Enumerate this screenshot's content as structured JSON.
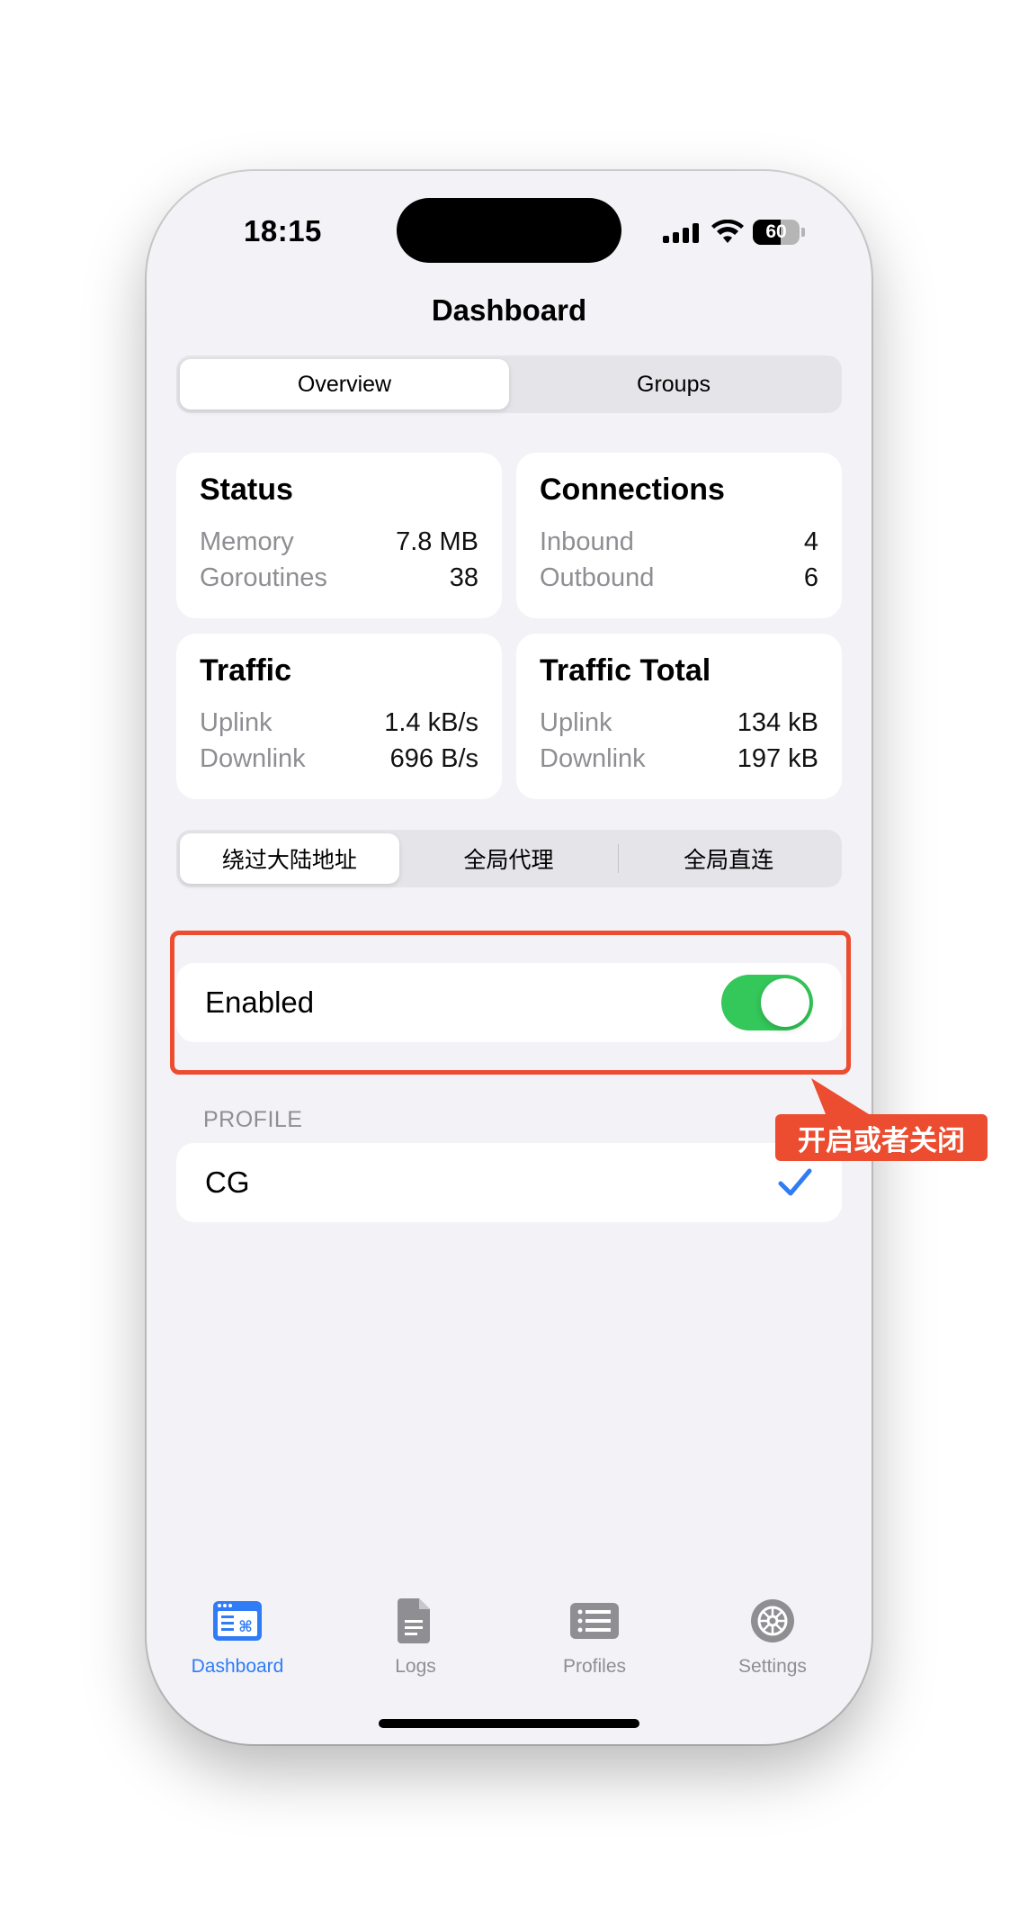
{
  "status_bar": {
    "time": "18:15",
    "battery_level": "60"
  },
  "nav": {
    "title": "Dashboard"
  },
  "view_segment": {
    "items": [
      {
        "label": "Overview",
        "selected": true
      },
      {
        "label": "Groups",
        "selected": false
      }
    ]
  },
  "cards": {
    "status": {
      "title": "Status",
      "rows": [
        {
          "key": "Memory",
          "value": "7.8 MB"
        },
        {
          "key": "Goroutines",
          "value": "38"
        }
      ]
    },
    "connections": {
      "title": "Connections",
      "rows": [
        {
          "key": "Inbound",
          "value": "4"
        },
        {
          "key": "Outbound",
          "value": "6"
        }
      ]
    },
    "traffic": {
      "title": "Traffic",
      "rows": [
        {
          "key": "Uplink",
          "value": "1.4 kB/s"
        },
        {
          "key": "Downlink",
          "value": "696 B/s"
        }
      ]
    },
    "traffic_total": {
      "title": "Traffic Total",
      "rows": [
        {
          "key": "Uplink",
          "value": "134 kB"
        },
        {
          "key": "Downlink",
          "value": "197 kB"
        }
      ]
    }
  },
  "mode_segment": {
    "items": [
      {
        "label": "绕过大陆地址",
        "selected": true
      },
      {
        "label": "全局代理",
        "selected": false
      },
      {
        "label": "全局直连",
        "selected": false
      }
    ]
  },
  "enabled_row": {
    "label": "Enabled",
    "on": true,
    "accent_color": "#34c759"
  },
  "profile_section": {
    "header": "PROFILE",
    "items": [
      {
        "name": "CG",
        "checked": true
      }
    ]
  },
  "annotation": {
    "text": "开启或者关闭",
    "color": "#ec4c2f"
  },
  "tabbar": {
    "active_color": "#2f7cf6",
    "tabs": [
      {
        "label": "Dashboard",
        "icon": "dashboard-icon",
        "active": true
      },
      {
        "label": "Logs",
        "icon": "document-icon",
        "active": false
      },
      {
        "label": "Profiles",
        "icon": "list-icon",
        "active": false
      },
      {
        "label": "Settings",
        "icon": "gear-icon",
        "active": false
      }
    ]
  }
}
